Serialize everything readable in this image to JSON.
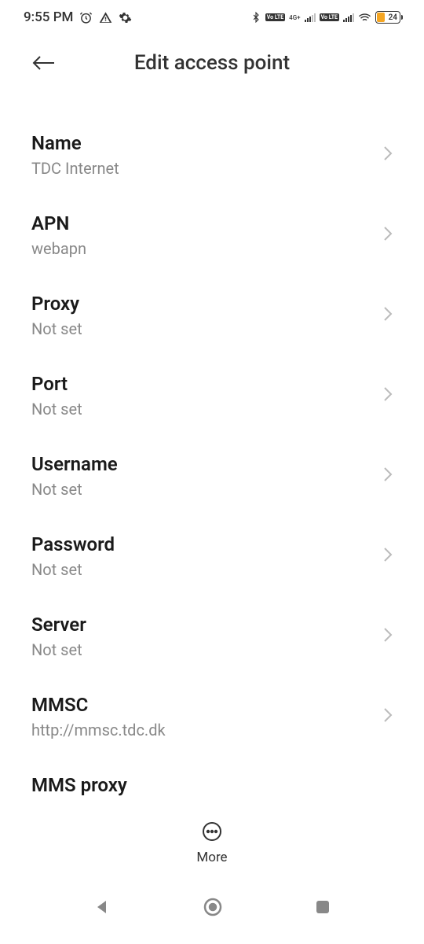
{
  "status": {
    "time": "9:55 PM",
    "battery": "24",
    "lte1": "Vo LTE",
    "net1": "4G+",
    "lte2": "Vo LTE"
  },
  "header": {
    "title": "Edit access point"
  },
  "items": [
    {
      "label": "Name",
      "value": "TDC Internet"
    },
    {
      "label": "APN",
      "value": "webapn"
    },
    {
      "label": "Proxy",
      "value": "Not set"
    },
    {
      "label": "Port",
      "value": "Not set"
    },
    {
      "label": "Username",
      "value": "Not set"
    },
    {
      "label": "Password",
      "value": "Not set"
    },
    {
      "label": "Server",
      "value": "Not set"
    },
    {
      "label": "MMSC",
      "value": "http://mmsc.tdc.dk"
    },
    {
      "label": "MMS proxy",
      "value": ""
    }
  ],
  "bottom": {
    "more": "More"
  }
}
